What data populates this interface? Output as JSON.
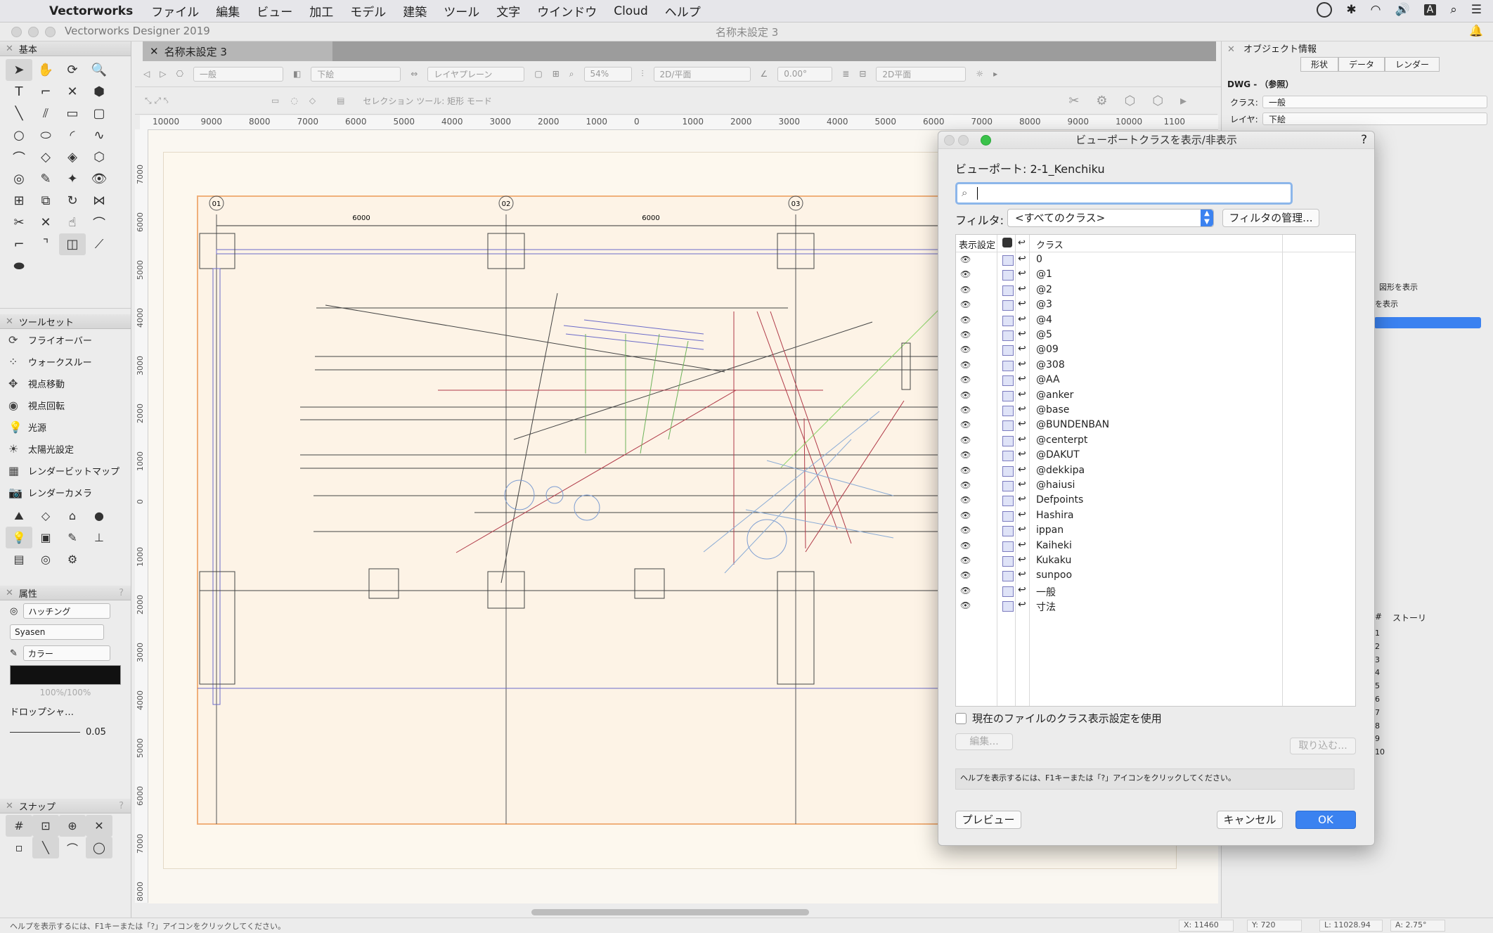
{
  "menubar": {
    "app": "Vectorworks",
    "items": [
      "ファイル",
      "編集",
      "ビュー",
      "加工",
      "モデル",
      "建築",
      "ツール",
      "文字",
      "ウインドウ",
      "Cloud",
      "ヘルプ"
    ]
  },
  "window": {
    "app_title": "Vectorworks Designer 2019",
    "doc_title": "名称未設定 3",
    "tab": "名称未設定 3"
  },
  "palettes": {
    "basic": "基本",
    "toolset": "ツールセット",
    "toolset_items": [
      "フライオーバー",
      "ウォークスルー",
      "視点移動",
      "視点回転",
      "光源",
      "太陽光設定",
      "レンダービットマップ",
      "レンダーカメラ"
    ],
    "attributes": "属性",
    "attr_fill": "ハッチング",
    "attr_fill_name": "Syasen",
    "attr_pen": "カラー",
    "attr_opacity": "100%/100%",
    "attr_drop": "ドロップシャ…",
    "attr_line": "0.05",
    "snap": "スナップ"
  },
  "viewbar": {
    "class": "一般",
    "layer": "下絵",
    "plane": "レイヤプレーン",
    "zoom": "54%",
    "view": "2D/平面",
    "angle": "0.00°",
    "render": "2D平面"
  },
  "modebar": {
    "mode_text": "セレクション ツール: 矩形 モード"
  },
  "ruler": {
    "top": [
      "10000",
      "9000",
      "8000",
      "7000",
      "6000",
      "5000",
      "4000",
      "3000",
      "2000",
      "1000",
      "0",
      "1000",
      "2000",
      "3000",
      "4000",
      "5000",
      "6000",
      "7000",
      "8000",
      "9000",
      "10000",
      "1100"
    ],
    "left": [
      "7000",
      "6000",
      "5000",
      "4000",
      "3000",
      "2000",
      "1000",
      "0",
      "1000",
      "2000",
      "3000",
      "4000",
      "5000",
      "6000",
      "7000",
      "8000"
    ]
  },
  "drawing": {
    "grid_labels": [
      "01",
      "02",
      "03"
    ],
    "dims": [
      "6000",
      "6000"
    ]
  },
  "objinfo": {
    "title": "オブジェクト情報",
    "tabs": [
      "形状",
      "データ",
      "レンダー"
    ],
    "dwg": "DWG - （参照）",
    "class_label": "クラス:",
    "class_value": "一般",
    "layer_label": "レイヤ:",
    "layer_value": "下絵",
    "show_shape": "図形を表示",
    "show2": "を表示",
    "story_hash": "#",
    "story_label": "ストーリ",
    "story_nums": [
      "1",
      "2",
      "3",
      "4",
      "5",
      "6",
      "7",
      "8",
      "9",
      "10"
    ]
  },
  "dialog": {
    "title": "ビューポートクラスを表示/非表示",
    "help": "?",
    "viewport": "ビューポート: 2-1_Kenchiku",
    "search_placeholder": "",
    "filter_label": "フィルタ:",
    "filter_value": "<すべてのクラス>",
    "filter_manage": "フィルタの管理...",
    "col_visibility": "表示設定",
    "col_class": "クラス",
    "classes": [
      "0",
      "@1",
      "@2",
      "@3",
      "@4",
      "@5",
      "@09",
      "@308",
      "@AA",
      "@anker",
      "@base",
      "@BUNDENBAN",
      "@centerpt",
      "@DAKUT",
      "@dekkipa",
      "@haiusi",
      "Defpoints",
      "Hashira",
      "ippan",
      "Kaiheki",
      "Kukaku",
      "sunpoo",
      "一般",
      "寸法"
    ],
    "use_file_settings": "現在のファイルのクラス表示設定を使用",
    "edit": "編集...",
    "import": "取り込む...",
    "help_text": "ヘルプを表示するには、F1キーまたは「?」アイコンをクリックしてください。",
    "preview": "プレビュー",
    "cancel": "キャンセル",
    "ok": "OK"
  },
  "status": {
    "help": "ヘルプを表示するには、F1キーまたは「?」アイコンをクリックしてください。",
    "x": "X: 11460",
    "y": "Y: 720",
    "l": "L: 11028.94",
    "a": "A: 2.75°"
  }
}
